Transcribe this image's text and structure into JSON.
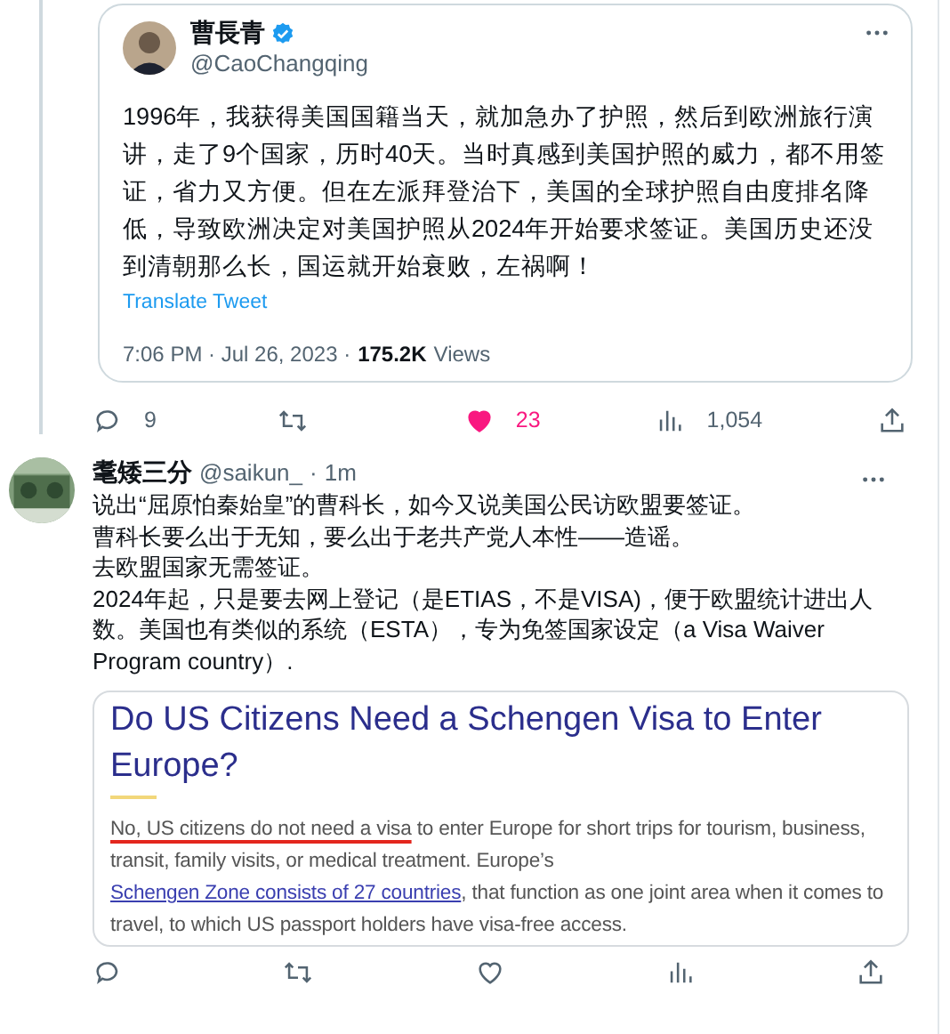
{
  "quoted_tweet": {
    "display_name": "曹長青",
    "verified": true,
    "handle": "@CaoChangqing",
    "text": "1996年，我获得美国国籍当天，就加急办了护照，然后到欧洲旅行演讲，走了9个国家，历时40天。当时真感到美国护照的威力，都不用签证，省力又方便。但在左派拜登治下，美国的全球护照自由度排名降低，导致欧洲决定对美国护照从2024年开始要求签证。美国历史还没到清朝那么长，国运就开始衰败，左祸啊！",
    "translate_link": "Translate Tweet",
    "time": "7:06 PM · Jul 26, 2023 ·",
    "views_count": "175.2K",
    "views_label": "Views"
  },
  "quoted_actions": [
    {
      "kind": "reply",
      "count": "9"
    },
    {
      "kind": "retweet"
    },
    {
      "kind": "like",
      "count": "23",
      "active": true
    },
    {
      "kind": "views",
      "count": "1,054"
    },
    {
      "kind": "share"
    }
  ],
  "reply": {
    "display_name": "耄矮三分",
    "handle": "@saikun_",
    "separator": "·",
    "time": "1m",
    "lines": [
      "说出“屈原怕秦始皇”的曹科长，如今又说美国公民访欧盟要签证。",
      "曹科长要么出于无知，要么出于老共产党人本性——造谣。",
      "去欧盟国家无需签证。",
      "2024年起，只是要去网上登记（是ETIAS，不是VISA)，便于欧盟统计进出人数。美国也有类似的系统（ESTA），专为免签国家设定（a Visa Waiver Program country）."
    ],
    "image": {
      "title": "Do US Citizens Need a Schengen Visa to Enter Europe?",
      "segments": [
        {
          "kind": "marked",
          "text": "No, US citizens do not need a visa"
        },
        {
          "kind": "plain",
          "text": " to enter Europe for short trips for tourism, business, transit, family visits, or medical treatment. Europe’s "
        },
        {
          "kind": "link",
          "text": "Schengen Zone consists of 27 countries"
        },
        {
          "kind": "plain",
          "text": ", that function as one joint area when it comes to travel, to which US passport holders have visa-free access."
        }
      ]
    },
    "actions": [
      {
        "kind": "reply"
      },
      {
        "kind": "retweet"
      },
      {
        "kind": "like",
        "active": false
      },
      {
        "kind": "views"
      },
      {
        "kind": "share"
      }
    ]
  }
}
